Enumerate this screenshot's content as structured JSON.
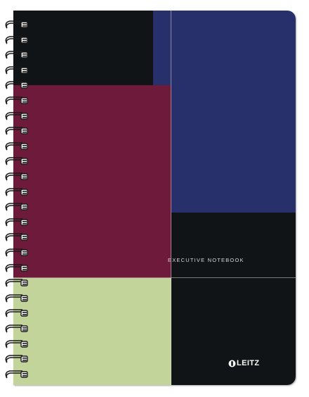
{
  "cover": {
    "title": "EXECUTIVE NOTEBOOK",
    "brand": "LEITZ"
  },
  "colors": {
    "black": "#101416",
    "navy": "#27306a",
    "burgundy": "#6e1a3b",
    "sage_green": "#c3d49a",
    "spiral": "#1a1a1a"
  },
  "spiral": {
    "ring_count": 24
  }
}
